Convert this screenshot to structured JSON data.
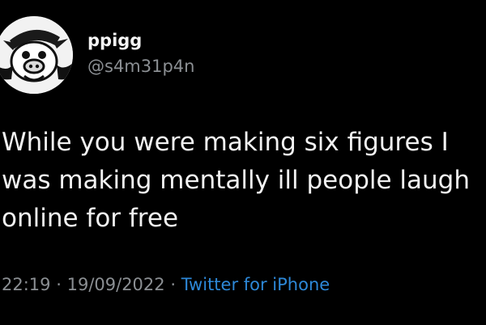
{
  "author": {
    "display_name": "ppigg",
    "handle": "@s4m31p4n",
    "avatar_icon": "pig-face-icon"
  },
  "tweet": {
    "text_lines": [
      "While you were making six figures I",
      "was making mentally ill people laugh",
      "online for free"
    ]
  },
  "meta": {
    "time": "22:19",
    "separator": "·",
    "date": "19/09/2022",
    "source": "Twitter for iPhone"
  },
  "colors": {
    "background": "#000000",
    "text": "#f2f2f2",
    "secondary": "#8b8f93",
    "link": "#2d88d8"
  }
}
